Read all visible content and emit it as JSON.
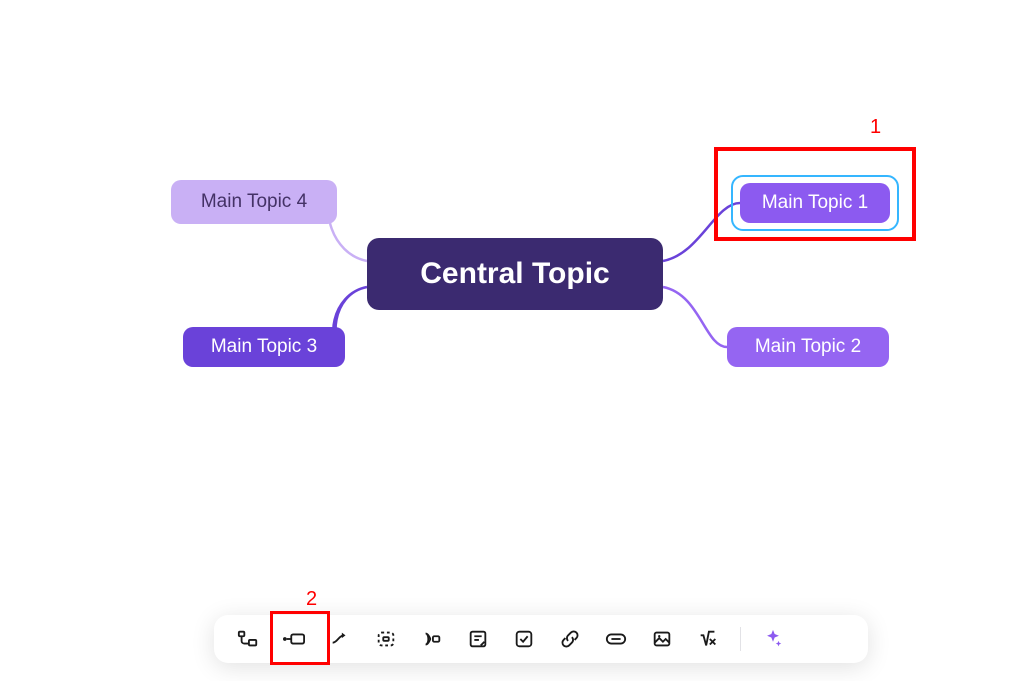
{
  "mindmap": {
    "central": "Central Topic",
    "topics": {
      "t1": "Main Topic 1",
      "t2": "Main Topic 2",
      "t3": "Main Topic 3",
      "t4": "Main Topic 4"
    },
    "selected": "t1"
  },
  "annotations": {
    "a1": "1",
    "a2": "2"
  },
  "toolbar": {
    "items": [
      "subtopic-icon",
      "floating-topic-icon",
      "relationship-icon",
      "boundary-icon",
      "summary-icon",
      "note-icon",
      "checkbox-icon",
      "hyperlink-icon",
      "attachment-icon",
      "image-icon",
      "equation-icon",
      "ai-icon"
    ]
  },
  "colors": {
    "central": "#3b2a70",
    "topic_light": "#c9b0f5",
    "topic_mid": "#9565f2",
    "topic_sel": "#8c5af0",
    "topic_dark": "#6a42d9",
    "selection": "#35b6ff",
    "annotation": "#ff0000",
    "spark": "#8c5af0"
  }
}
